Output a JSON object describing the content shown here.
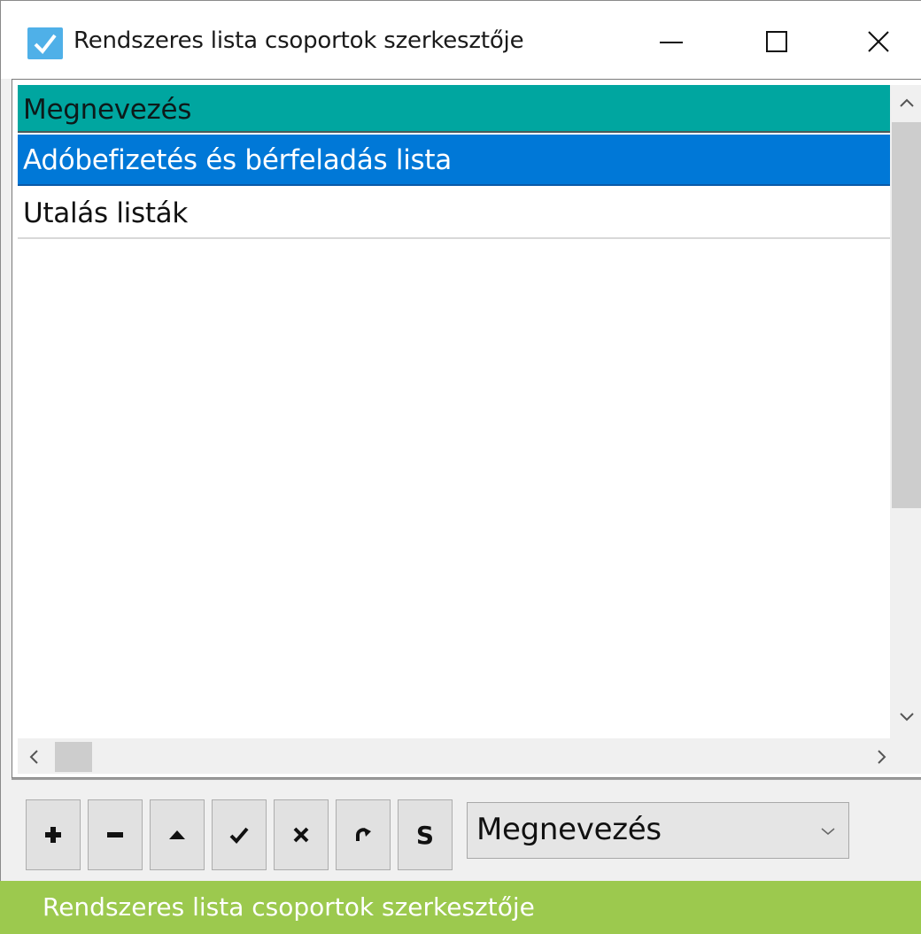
{
  "window": {
    "title": "Rendszeres lista csoportok szerkesztője",
    "app_icon": "checkmark-icon",
    "controls": [
      "minimize-icon",
      "maximize-icon",
      "close-icon"
    ]
  },
  "list": {
    "header": "Megnevezés",
    "rows": [
      {
        "label": "Adóbefizetés és bérfeladás lista",
        "selected": true
      },
      {
        "label": "Utalás listák",
        "selected": false
      }
    ]
  },
  "toolbar": {
    "buttons": [
      {
        "name": "add-button",
        "icon": "plus-icon"
      },
      {
        "name": "remove-button",
        "icon": "minus-icon"
      },
      {
        "name": "move-up-button",
        "icon": "triangle-up-icon"
      },
      {
        "name": "confirm-button",
        "icon": "check-icon"
      },
      {
        "name": "cancel-button",
        "icon": "x-icon"
      },
      {
        "name": "refresh-button",
        "icon": "redo-icon"
      },
      {
        "name": "s-button",
        "label": "S"
      }
    ],
    "sort_select_value": "Megnevezés"
  },
  "caption": "Rendszeres lista csoportok szerkesztője",
  "colors": {
    "header_bg": "#00a6a0",
    "selected_row_bg": "#0078d7",
    "caption_bg": "#9cc94e",
    "app_icon_bg": "#4fb0e8"
  }
}
